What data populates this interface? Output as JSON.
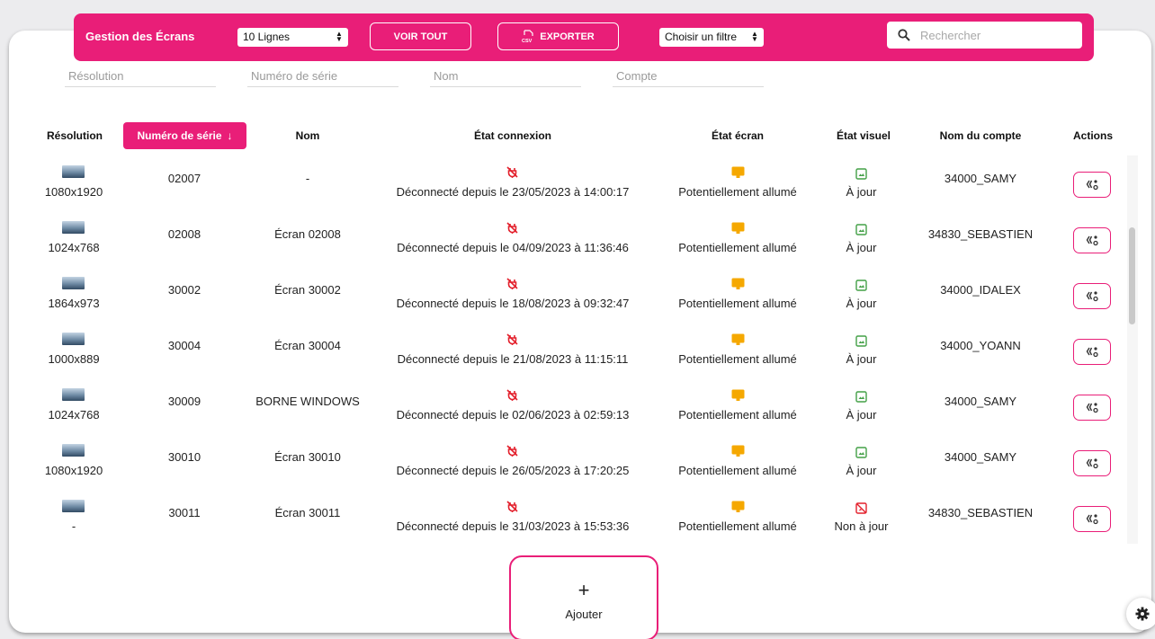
{
  "toolbar": {
    "title": "Gestion des Écrans",
    "lines_select": "10 Lignes",
    "view_all": "VOIR TOUT",
    "export": "EXPORTER",
    "filter_select": "Choisir un filtre",
    "search_placeholder": "Rechercher"
  },
  "filters": {
    "resolution": "Résolution",
    "serial": "Numéro de série",
    "name": "Nom",
    "account": "Compte"
  },
  "columns": {
    "resolution": "Résolution",
    "serial": "Numéro de série",
    "name": "Nom",
    "connection": "État connexion",
    "screen": "État écran",
    "visual": "État visuel",
    "account": "Nom du compte",
    "actions": "Actions"
  },
  "rows": [
    {
      "resolution": "1080x1920",
      "serial": "02007",
      "name": "-",
      "connection": "Déconnecté depuis le 23/05/2023 à 14:00:17",
      "screen": "Potentiellement allumé",
      "visual": "À jour",
      "visual_ok": true,
      "account": "34000_SAMY"
    },
    {
      "resolution": "1024x768",
      "serial": "02008",
      "name": "Écran 02008",
      "connection": "Déconnecté depuis le 04/09/2023 à 11:36:46",
      "screen": "Potentiellement allumé",
      "visual": "À jour",
      "visual_ok": true,
      "account": "34830_SEBASTIEN"
    },
    {
      "resolution": "1864x973",
      "serial": "30002",
      "name": "Écran 30002",
      "connection": "Déconnecté depuis le 18/08/2023 à 09:32:47",
      "screen": "Potentiellement allumé",
      "visual": "À jour",
      "visual_ok": true,
      "account": "34000_IDALEX"
    },
    {
      "resolution": "1000x889",
      "serial": "30004",
      "name": "Écran 30004",
      "connection": "Déconnecté depuis le 21/08/2023 à 11:15:11",
      "screen": "Potentiellement allumé",
      "visual": "À jour",
      "visual_ok": true,
      "account": "34000_YOANN"
    },
    {
      "resolution": "1024x768",
      "serial": "30009",
      "name": "BORNE WINDOWS",
      "connection": "Déconnecté depuis le 02/06/2023 à 02:59:13",
      "screen": "Potentiellement allumé",
      "visual": "À jour",
      "visual_ok": true,
      "account": "34000_SAMY"
    },
    {
      "resolution": "1080x1920",
      "serial": "30010",
      "name": "Écran 30010",
      "connection": "Déconnecté depuis le 26/05/2023 à 17:20:25",
      "screen": "Potentiellement allumé",
      "visual": "À jour",
      "visual_ok": true,
      "account": "34000_SAMY"
    },
    {
      "resolution": "-",
      "serial": "30011",
      "name": "Écran 30011",
      "connection": "Déconnecté depuis le 31/03/2023 à 15:53:36",
      "screen": "Potentiellement allumé",
      "visual": "Non à jour",
      "visual_ok": false,
      "account": "34830_SEBASTIEN"
    }
  ],
  "add": {
    "plus": "+",
    "label": "Ajouter"
  },
  "icons": {
    "disconnected": "plug-off-icon",
    "screen": "monitor-icon",
    "visual_ok": "image-check-icon",
    "visual_outdated": "image-off-icon",
    "action": "sync-settings-icon",
    "settings": "gear-icon",
    "search": "search-icon",
    "export": "csv-file-icon"
  },
  "colors": {
    "accent": "#e91e78",
    "disconnected": "#e3202c",
    "screen_on": "#f5a800",
    "visual_ok": "#43a047",
    "visual_bad": "#e3202c"
  }
}
